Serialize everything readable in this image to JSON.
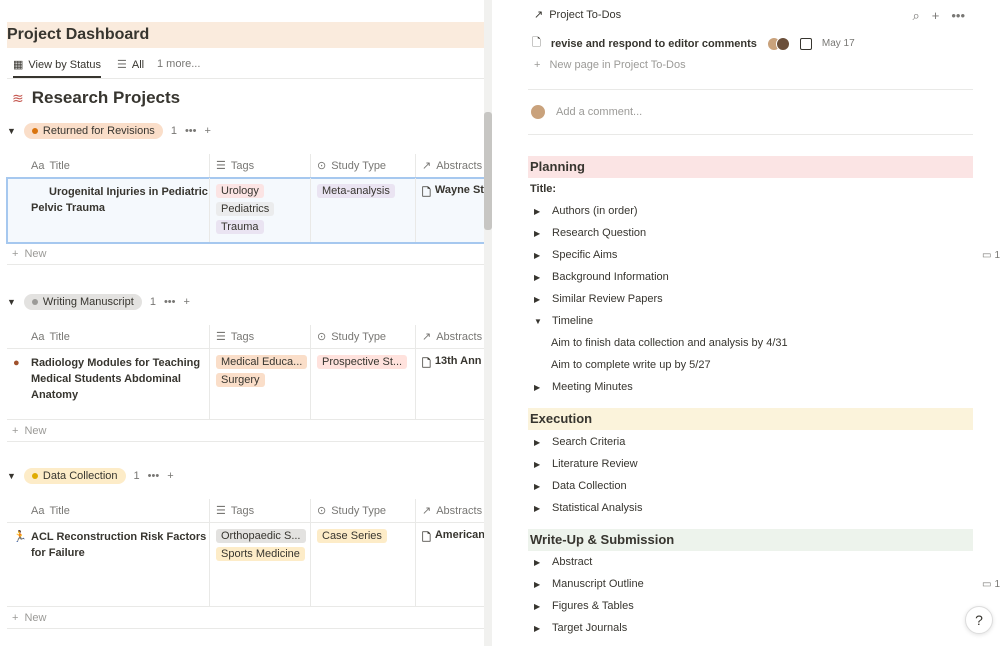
{
  "left": {
    "page_title": "Project Dashboard",
    "views": [
      {
        "label": "View by Status",
        "icon": "table-icon"
      },
      {
        "label": "All",
        "icon": "list-icon"
      },
      {
        "label": "1 more..."
      }
    ],
    "db_title": "Research Projects",
    "columns": {
      "title": "Title",
      "title_prefix": "Aa",
      "tags": "Tags",
      "study_type": "Study Type",
      "abstracts": "Abstracts"
    },
    "groups": [
      {
        "status": "Returned for Revisions",
        "count": "1",
        "color_bg": "#fadec9",
        "color_dot": "#d9730d",
        "row": {
          "title": "Urogenital Injuries in Pediatric Pelvic Trauma",
          "tags": [
            "Urology",
            "Pediatrics",
            "Trauma"
          ],
          "study_type": "Meta-analysis",
          "abstract": "Wayne St"
        }
      },
      {
        "status": "Writing Manuscript",
        "count": "1",
        "color_bg": "#e3e2e0",
        "color_dot": "#9b9a97",
        "row": {
          "title": "Radiology Modules for Teaching Medical Students Abdominal Anatomy",
          "tags": [
            "Medical Educa...",
            "Surgery"
          ],
          "study_type": "Prospective St...",
          "abstract": "13th Ann"
        }
      },
      {
        "status": "Data Collection",
        "count": "1",
        "color_bg": "#fdecc8",
        "color_dot": "#dfab01",
        "row": {
          "title": "ACL Reconstruction Risk Factors for Failure",
          "tags": [
            "Orthopaedic S...",
            "Sports Medicine"
          ],
          "study_type": "Case Series",
          "abstract": "American"
        }
      }
    ],
    "new_label": "New"
  },
  "right": {
    "breadcrumb": "Project To-Dos",
    "todo": {
      "name": "revise and respond to editor comments",
      "date": "May 17"
    },
    "new_page": "New page in Project To-Dos",
    "comment_placeholder": "Add a comment...",
    "planning": {
      "heading": "Planning",
      "title_label": "Title:",
      "items": [
        "Authors (in order)",
        "Research Question",
        "Specific Aims",
        "Background Information",
        "Similar Review Papers",
        "Timeline"
      ],
      "timeline_sub": [
        "Aim to finish data collection and analysis by 4/31",
        "Aim to complete write up by 5/27"
      ],
      "after": "Meeting Minutes"
    },
    "execution": {
      "heading": "Execution",
      "items": [
        "Search Criteria",
        "Literature Review",
        "Data Collection",
        "Statistical Analysis"
      ]
    },
    "writeup": {
      "heading": "Write-Up & Submission",
      "items": [
        "Abstract",
        "Manuscript Outline",
        "Figures & Tables",
        "Target Journals"
      ]
    },
    "comment_count": "1",
    "help": "?"
  },
  "colors": {
    "planning_bg": "#fbe4e4",
    "execution_bg": "#fbf3db",
    "writeup_bg": "#edf3ec"
  }
}
